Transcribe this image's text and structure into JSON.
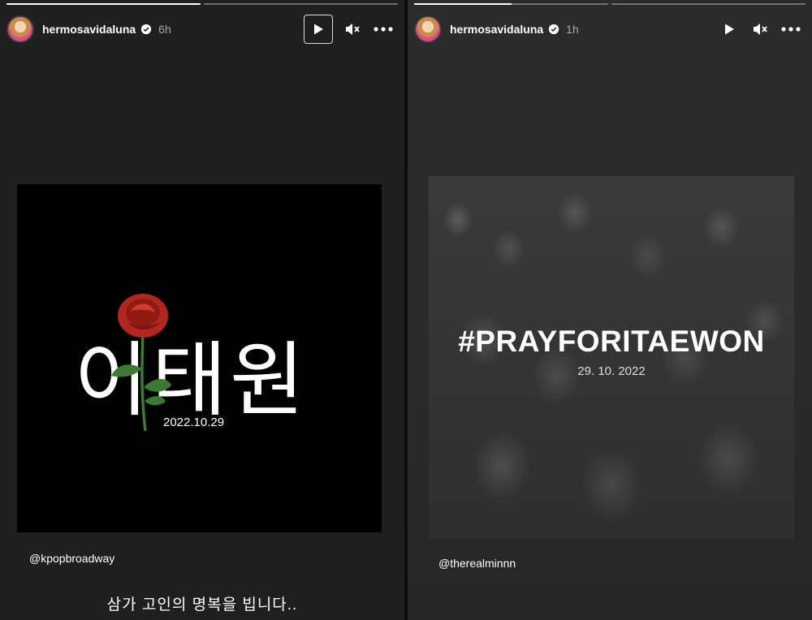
{
  "left_story": {
    "username": "hermosavidaluna",
    "time": "6h",
    "progress": [
      1.0,
      0.0
    ],
    "post": {
      "title": "이태원",
      "date": "2022.10.29"
    },
    "mention": "@kpopbroadway",
    "caption": "삼가 고인의 명복을 빕니다.."
  },
  "right_story": {
    "username": "hermosavidaluna",
    "time": "1h",
    "progress": [
      0.5,
      0.0
    ],
    "post": {
      "title": "#PRAYFORITAEWON",
      "date": "29. 10. 2022"
    },
    "mention": "@therealminnn"
  },
  "icons": {
    "play": "play-icon",
    "mute": "mute-icon",
    "more": "more-icon",
    "verified": "verified-badge-icon"
  },
  "colors": {
    "rose": "#b3261e",
    "stem": "#3c7a34",
    "background": "#1f1f1f"
  }
}
